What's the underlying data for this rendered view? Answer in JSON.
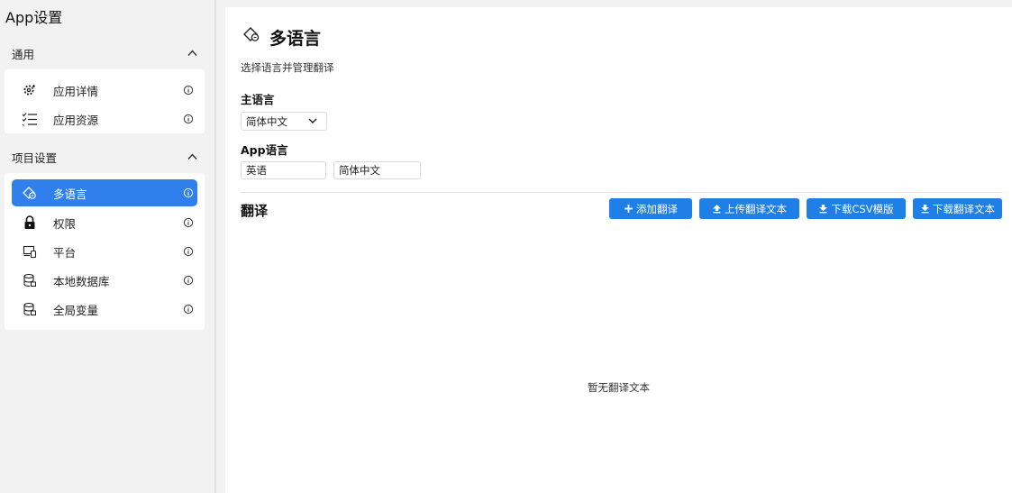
{
  "app": {
    "title": "App设置"
  },
  "sidebar": {
    "groups": [
      {
        "label": "通用",
        "items": [
          {
            "label": "应用详情",
            "icon": "gear-icon"
          },
          {
            "label": "应用资源",
            "icon": "list-icon"
          }
        ]
      },
      {
        "label": "项目设置",
        "items": [
          {
            "label": "多语言",
            "icon": "translate-icon",
            "active": true
          },
          {
            "label": "权限",
            "icon": "lock-icon"
          },
          {
            "label": "平台",
            "icon": "devices-icon"
          },
          {
            "label": "本地数据库",
            "icon": "database-icon"
          },
          {
            "label": "全局变量",
            "icon": "database-icon"
          }
        ]
      }
    ]
  },
  "main": {
    "title": "多语言",
    "subtitle": "选择语言并管理翻译",
    "primary_language": {
      "label": "主语言",
      "value": "简体中文"
    },
    "app_languages": {
      "label": "App语言",
      "values": [
        "英语",
        "简体中文"
      ]
    },
    "translations": {
      "title": "翻译",
      "buttons": {
        "add": "添加翻译",
        "upload": "上传翻译文本",
        "download_csv": "下载CSV模版",
        "download": "下载翻译文本"
      },
      "empty_text": "暂无翻译文本"
    }
  },
  "colors": {
    "accent": "#1e7fe6",
    "active_nav": "#2f80ed",
    "background": "#f2f2f2",
    "panel": "#ffffff"
  }
}
